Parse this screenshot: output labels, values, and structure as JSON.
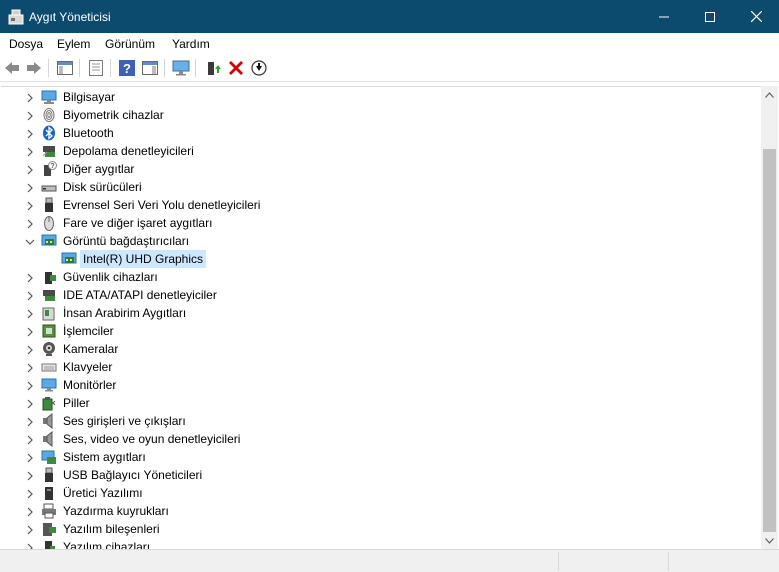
{
  "window": {
    "title": "Aygıt Yöneticisi"
  },
  "menu": [
    {
      "label": "Dosya"
    },
    {
      "label": "Eylem"
    },
    {
      "label": "Görünüm"
    },
    {
      "label": "Yardım"
    }
  ],
  "toolbar": [
    {
      "icon": "back-arrow-icon"
    },
    {
      "icon": "forward-arrow-icon"
    },
    {
      "icon": "show-hide-console-tree-icon"
    },
    {
      "icon": "properties-icon"
    },
    {
      "icon": "help-icon"
    },
    {
      "icon": "action-pane-icon"
    },
    {
      "icon": "scan-hardware-changes-icon"
    },
    {
      "icon": "update-driver-icon"
    },
    {
      "icon": "uninstall-device-icon"
    },
    {
      "icon": "download-icon"
    }
  ],
  "tree": [
    {
      "label": "Bilgisayar",
      "icon": "computer-icon",
      "expanded": false,
      "level": 0
    },
    {
      "label": "Biyometrik cihazlar",
      "icon": "fingerprint-icon",
      "expanded": false,
      "level": 0
    },
    {
      "label": "Bluetooth",
      "icon": "bluetooth-icon",
      "expanded": false,
      "level": 0
    },
    {
      "label": "Depolama denetleyicileri",
      "icon": "storage-controller-icon",
      "expanded": false,
      "level": 0
    },
    {
      "label": "Diğer aygıtlar",
      "icon": "unknown-device-icon",
      "expanded": false,
      "level": 0
    },
    {
      "label": "Disk sürücüleri",
      "icon": "disk-drive-icon",
      "expanded": false,
      "level": 0
    },
    {
      "label": "Evrensel Seri Veri Yolu denetleyicileri",
      "icon": "usb-connector-icon",
      "expanded": false,
      "level": 0
    },
    {
      "label": "Fare ve diğer işaret aygıtları",
      "icon": "mouse-icon",
      "expanded": false,
      "level": 0
    },
    {
      "label": "Görüntü bağdaştırıcıları",
      "icon": "display-adapter-icon",
      "expanded": true,
      "level": 0
    },
    {
      "label": "Intel(R) UHD Graphics",
      "icon": "display-adapter-icon",
      "expanded": null,
      "level": 1,
      "selected": true
    },
    {
      "label": "Güvenlik cihazları",
      "icon": "security-device-icon",
      "expanded": false,
      "level": 0
    },
    {
      "label": "IDE ATA/ATAPI denetleyiciler",
      "icon": "ide-controller-icon",
      "expanded": false,
      "level": 0
    },
    {
      "label": "İnsan Arabirim Aygıtları",
      "icon": "hid-icon",
      "expanded": false,
      "level": 0
    },
    {
      "label": "İşlemciler",
      "icon": "processor-icon",
      "expanded": false,
      "level": 0
    },
    {
      "label": "Kameralar",
      "icon": "camera-icon",
      "expanded": false,
      "level": 0
    },
    {
      "label": "Klavyeler",
      "icon": "keyboard-icon",
      "expanded": false,
      "level": 0
    },
    {
      "label": "Monitörler",
      "icon": "monitor-icon",
      "expanded": false,
      "level": 0
    },
    {
      "label": "Piller",
      "icon": "battery-icon",
      "expanded": false,
      "level": 0
    },
    {
      "label": "Ses girişleri ve çıkışları",
      "icon": "speaker-icon",
      "expanded": false,
      "level": 0
    },
    {
      "label": "Ses, video ve oyun denetleyicileri",
      "icon": "speaker-icon",
      "expanded": false,
      "level": 0
    },
    {
      "label": "Sistem aygıtları",
      "icon": "system-device-icon",
      "expanded": false,
      "level": 0
    },
    {
      "label": "USB Bağlayıcı Yöneticileri",
      "icon": "usb-connector-icon",
      "expanded": false,
      "level": 0
    },
    {
      "label": "Üretici Yazılımı",
      "icon": "firmware-icon",
      "expanded": false,
      "level": 0
    },
    {
      "label": "Yazdırma kuyrukları",
      "icon": "printer-icon",
      "expanded": false,
      "level": 0
    },
    {
      "label": "Yazılım bileşenleri",
      "icon": "software-component-icon",
      "expanded": false,
      "level": 0
    },
    {
      "label": "Yazılım cihazları",
      "icon": "software-device-icon",
      "expanded": false,
      "level": 0
    }
  ],
  "colors": {
    "titlebar": "#0c4a6e",
    "selection": "#cce8ff",
    "uninstall": "#d40000"
  }
}
